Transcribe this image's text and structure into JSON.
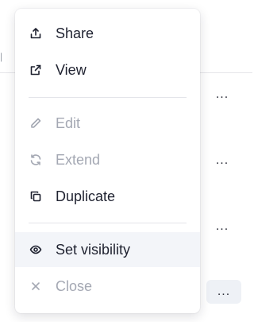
{
  "menu": {
    "items": [
      {
        "label": "Share",
        "icon": "share-icon",
        "disabled": false
      },
      {
        "label": "View",
        "icon": "external-link-icon",
        "disabled": false
      },
      {
        "label": "Edit",
        "icon": "pencil-icon",
        "disabled": true
      },
      {
        "label": "Extend",
        "icon": "refresh-icon",
        "disabled": true
      },
      {
        "label": "Duplicate",
        "icon": "copy-icon",
        "disabled": false
      },
      {
        "label": "Set visibility",
        "icon": "eye-icon",
        "disabled": false,
        "highlighted": true
      },
      {
        "label": "Close",
        "icon": "close-icon",
        "disabled": true
      }
    ]
  },
  "background": {
    "more_label": "..."
  }
}
